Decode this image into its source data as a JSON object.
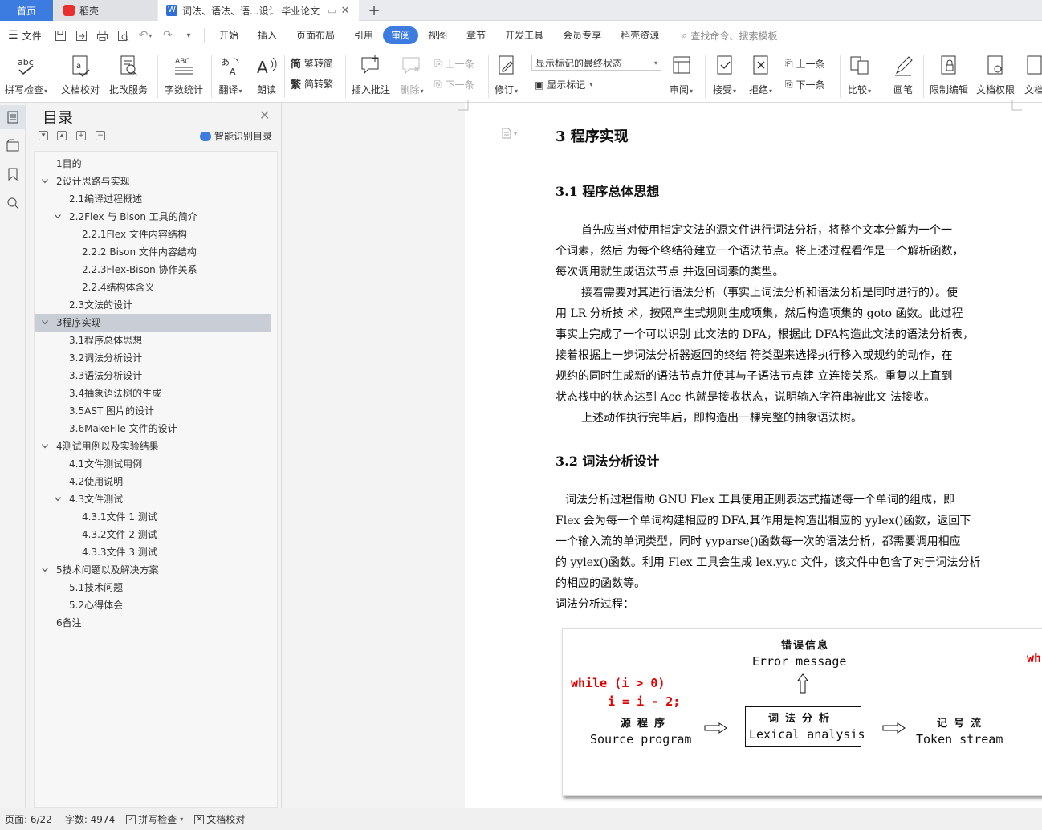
{
  "tabs": {
    "home": "首页",
    "daoke": "稻壳",
    "document": "词法、语法、语...设计 毕业论文",
    "add": "+"
  },
  "menu": {
    "file": "文件",
    "items": [
      "开始",
      "插入",
      "页面布局",
      "引用",
      "审阅",
      "视图",
      "章节",
      "开发工具",
      "会员专享",
      "稻壳资源"
    ],
    "active_index": 4,
    "search_placeholder": "查找命令、搜索模板"
  },
  "ribbon": {
    "spell_check": "拼写检查",
    "doc_proof": "文档校对",
    "batch_service": "批改服务",
    "word_count": "字数统计",
    "translate": "翻译",
    "read_aloud": "朗读",
    "trad_to_simp": "繁转简",
    "simp_to_trad": "简转繁",
    "insert_comment": "插入批注",
    "delete": "删除",
    "prev_comment": "上一条",
    "next_comment": "下一条",
    "track_changes": "修订",
    "markup_mode": "显示标记的最终状态",
    "show_markup": "显示标记",
    "review": "审阅",
    "accept": "接受",
    "reject": "拒绝",
    "prev_change": "上一条",
    "next_change": "下一条",
    "compare": "比较",
    "ink": "画笔",
    "restrict_editing": "限制编辑",
    "doc_permission": "文档权限",
    "doc_more": "文档"
  },
  "toc": {
    "title": "目录",
    "smart_label": "智能识别目录",
    "items": [
      {
        "text": "1目的",
        "level": 1,
        "arrow": ""
      },
      {
        "text": "2设计思路与实现",
        "level": 1,
        "arrow": "down"
      },
      {
        "text": "2.1编译过程概述",
        "level": 2,
        "arrow": ""
      },
      {
        "text": "2.2Flex 与 Bison 工具的简介",
        "level": 2,
        "arrow": "down"
      },
      {
        "text": "2.2.1Flex 文件内容结构",
        "level": 3,
        "arrow": ""
      },
      {
        "text": "2.2.2 Bison 文件内容结构",
        "level": 3,
        "arrow": ""
      },
      {
        "text": "2.2.3Flex-Bison 协作关系",
        "level": 3,
        "arrow": ""
      },
      {
        "text": "2.2.4结构体含义",
        "level": 3,
        "arrow": ""
      },
      {
        "text": "2.3文法的设计",
        "level": 2,
        "arrow": ""
      },
      {
        "text": "3程序实现",
        "level": 1,
        "arrow": "down",
        "selected": true
      },
      {
        "text": "3.1程序总体思想",
        "level": 2,
        "arrow": ""
      },
      {
        "text": "3.2词法分析设计",
        "level": 2,
        "arrow": ""
      },
      {
        "text": "3.3语法分析设计",
        "level": 2,
        "arrow": ""
      },
      {
        "text": "3.4抽象语法树的生成",
        "level": 2,
        "arrow": ""
      },
      {
        "text": "3.5AST 图片的设计",
        "level": 2,
        "arrow": ""
      },
      {
        "text": "3.6MakeFile 文件的设计",
        "level": 2,
        "arrow": ""
      },
      {
        "text": "4测试用例以及实验结果",
        "level": 1,
        "arrow": "down"
      },
      {
        "text": "4.1文件测试用例",
        "level": 2,
        "arrow": ""
      },
      {
        "text": "4.2使用说明",
        "level": 2,
        "arrow": ""
      },
      {
        "text": "4.3文件测试",
        "level": 2,
        "arrow": "down"
      },
      {
        "text": "4.3.1文件 1 测试",
        "level": 3,
        "arrow": ""
      },
      {
        "text": "4.3.2文件 2 测试",
        "level": 3,
        "arrow": ""
      },
      {
        "text": "4.3.3文件 3 测试",
        "level": 3,
        "arrow": ""
      },
      {
        "text": "5技术问题以及解决方案",
        "level": 1,
        "arrow": "down"
      },
      {
        "text": "5.1技术问题",
        "level": 2,
        "arrow": ""
      },
      {
        "text": "5.2心得体会",
        "level": 2,
        "arrow": ""
      },
      {
        "text": "6备注",
        "level": 1,
        "arrow": ""
      }
    ]
  },
  "document": {
    "h1": "3 程序实现",
    "h2_1": "3.1 程序总体思想",
    "para1": [
      "首先应当对使用指定文法的源文件进行词法分析，将整个文本分解为一个一",
      "个词素，然后 为每个终结符建立一个语法节点。将上述过程看作是一个解析函数，",
      "每次调用就生成语法节点 并返回词素的类型。",
      "接着需要对其进行语法分析（事实上词法分析和语法分析是同时进行的）。使",
      "用 LR 分析技 术，按照产生式规则生成项集，然后构造项集的 goto 函数。此过程",
      "事实上完成了一个可以识别 此文法的 DFA，根据此 DFA构造此文法的语法分析表，",
      "接着根据上一步词法分析器返回的终结 符类型来选择执行移入或规约的动作，在",
      "规约的同时生成新的语法节点并使其与子语法节点建 立连接关系。重复以上直到",
      "状态栈中的状态达到 Acc 也就是接收状态，说明输入字符串被此文 法接收。",
      "上述动作执行完毕后，即构造出一棵完整的抽象语法树。"
    ],
    "h2_2": "3.2 词法分析设计",
    "para2": [
      "词法分析过程借助 GNU Flex 工具使用正则表达式描述每一个单词的组成，即",
      "Flex 会为每一个单词构建相应的 DFA,其作用是构造出相应的 yylex()函数，返回下",
      "一个输入流的单词类型，同时 yyparse()函数每一次的语法分析，都需要调用相应",
      "的 yylex()函数。利用 Flex 工具会生成 lex.yy.c 文件，该文件中包含了对于词法分析",
      "的相应的函数等。",
      "词法分析过程："
    ],
    "figure": {
      "error_cn": "错误信息",
      "error_en": "Error message",
      "code_line1": "while  (i  >  0)",
      "code_line2": "i  =  i  -  2;",
      "source_cn": "源程序",
      "source_en": "Source program",
      "lexical_cn": "词法分析",
      "lexical_en": "Lexical analysis",
      "token_cn": "记号流",
      "token_en": "Token stream",
      "right_code": "wh"
    }
  },
  "status": {
    "page": "页面: 6/22",
    "word_count": "字数: 4974",
    "spell_check": "拼写检查",
    "doc_proof": "文档校对"
  }
}
